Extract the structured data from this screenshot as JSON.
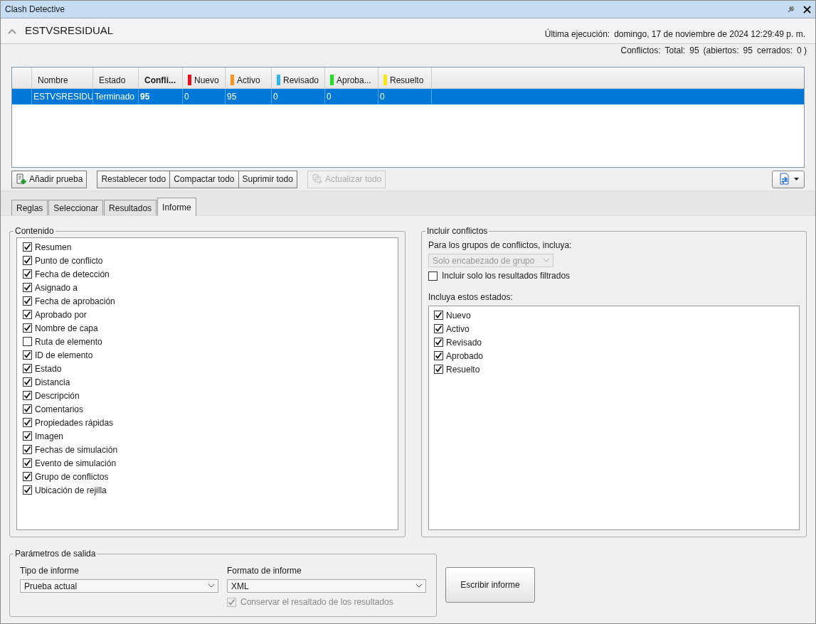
{
  "window": {
    "title": "Clash Detective"
  },
  "test": {
    "name": "ESTVSRESIDUAL",
    "expanded": true,
    "last_run_label": "Última ejecución:",
    "last_run": "domingo, 17 de noviembre de 2024 12:29:49 p. m.",
    "conflicts": [
      {
        "label": "Conflictos:"
      },
      {
        "label": "Total:"
      },
      {
        "label": "95"
      },
      {
        "label": "(abiertos:"
      },
      {
        "label": "95"
      },
      {
        "label": "cerrados:"
      },
      {
        "label": "0 )"
      }
    ]
  },
  "table": {
    "columns": [
      {
        "label": "Nombre",
        "bold": false
      },
      {
        "label": "Estado",
        "bold": false
      },
      {
        "label": "Confli...",
        "bold": true
      },
      {
        "label": "Nuevo",
        "bold": false,
        "color": "#e81123"
      },
      {
        "label": "Activo",
        "bold": false,
        "color": "#f7941d"
      },
      {
        "label": "Revisado",
        "bold": false,
        "color": "#2bb5e8"
      },
      {
        "label": "Aproba...",
        "bold": false,
        "color": "#22dd22"
      },
      {
        "label": "Resuelto",
        "bold": false,
        "color": "#f5e614"
      }
    ],
    "rows": [
      {
        "selected": true,
        "cells": [
          "ESTVSRESIDU",
          "Terminado",
          "95",
          "0",
          "95",
          "0",
          "0",
          "0"
        ]
      }
    ]
  },
  "toolbar": {
    "groups": [
      {
        "buttons": [
          {
            "label": "Añadir prueba",
            "disabled": false
          }
        ]
      },
      {
        "buttons": [
          {
            "label": "Restablecer todo",
            "disabled": false
          },
          {
            "label": "Compactar todo",
            "disabled": false
          },
          {
            "label": "Suprimir todo",
            "disabled": false
          }
        ]
      },
      {
        "buttons": [
          {
            "label": "Actualizar todo",
            "disabled": true
          }
        ]
      }
    ]
  },
  "tabs": [
    {
      "label": "Reglas",
      "selected": false
    },
    {
      "label": "Seleccionar",
      "selected": false
    },
    {
      "label": "Resultados",
      "selected": false
    },
    {
      "label": "Informe",
      "selected": true
    }
  ],
  "contenido": {
    "title": "Contenido",
    "items": [
      {
        "label": "Resumen",
        "checked": true
      },
      {
        "label": "Punto de conflicto",
        "checked": true
      },
      {
        "label": "Fecha de detección",
        "checked": true
      },
      {
        "label": "Asignado a",
        "checked": true
      },
      {
        "label": "Fecha de aprobación",
        "checked": true
      },
      {
        "label": "Aprobado por",
        "checked": true
      },
      {
        "label": "Nombre de capa",
        "checked": true
      },
      {
        "label": "Ruta de elemento",
        "checked": false
      },
      {
        "label": "ID de elemento",
        "checked": true
      },
      {
        "label": "Estado",
        "checked": true
      },
      {
        "label": "Distancia",
        "checked": true
      },
      {
        "label": "Descripción",
        "checked": true
      },
      {
        "label": "Comentarios",
        "checked": true
      },
      {
        "label": "Propiedades rápidas",
        "checked": true
      },
      {
        "label": "Imagen",
        "checked": true
      },
      {
        "label": "Fechas de simulación",
        "checked": true
      },
      {
        "label": "Evento de simulación",
        "checked": true
      },
      {
        "label": "Grupo de conflictos",
        "checked": true
      },
      {
        "label": "Ubicación de rejilla",
        "checked": true
      }
    ]
  },
  "incluir": {
    "title": "Incluir conflictos",
    "groups_label": "Para los grupos de conflictos, incluya:",
    "groups_value": "Solo encabezado de grupo",
    "groups_disabled": true,
    "filtered": {
      "label": "Incluir solo los resultados filtrados",
      "checked": false
    },
    "states_label": "Incluya estos estados:",
    "states": [
      {
        "label": "Nuevo",
        "checked": true
      },
      {
        "label": "Activo",
        "checked": true
      },
      {
        "label": "Revisado",
        "checked": true
      },
      {
        "label": "Aprobado",
        "checked": true
      },
      {
        "label": "Resuelto",
        "checked": true
      }
    ]
  },
  "salida": {
    "title": "Parámetros de salida",
    "type_label": "Tipo de informe",
    "type_value": "Prueba actual",
    "format_label": "Formato de informe",
    "format_value": "XML",
    "keep": {
      "label": "Conservar el resaltado de los resultados",
      "checked": true,
      "disabled": true
    },
    "write_button": "Escribir informe"
  }
}
